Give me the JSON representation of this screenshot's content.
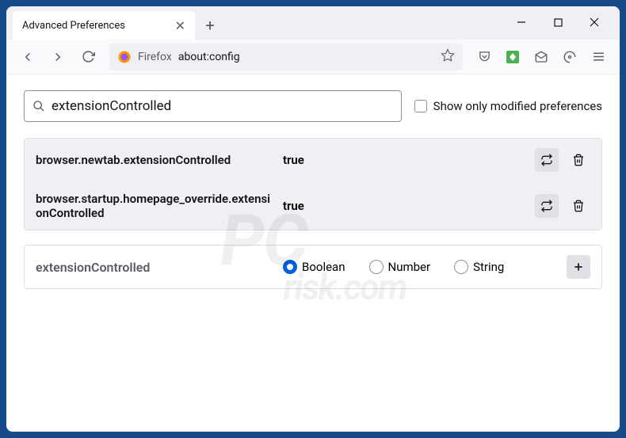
{
  "tab": {
    "title": "Advanced Preferences"
  },
  "urlbar": {
    "brand": "Firefox",
    "address": "about:config"
  },
  "search": {
    "value": "extensionControlled",
    "checkbox_label": "Show only modified preferences"
  },
  "results": [
    {
      "name": "browser.newtab.extensionControlled",
      "value": "true"
    },
    {
      "name": "browser.startup.homepage_override.extensionControlled",
      "value": "true"
    }
  ],
  "add": {
    "name": "extensionControlled",
    "types": [
      "Boolean",
      "Number",
      "String"
    ],
    "selected": "Boolean"
  },
  "watermark": {
    "main": "PC",
    "sub": "risk.com"
  }
}
